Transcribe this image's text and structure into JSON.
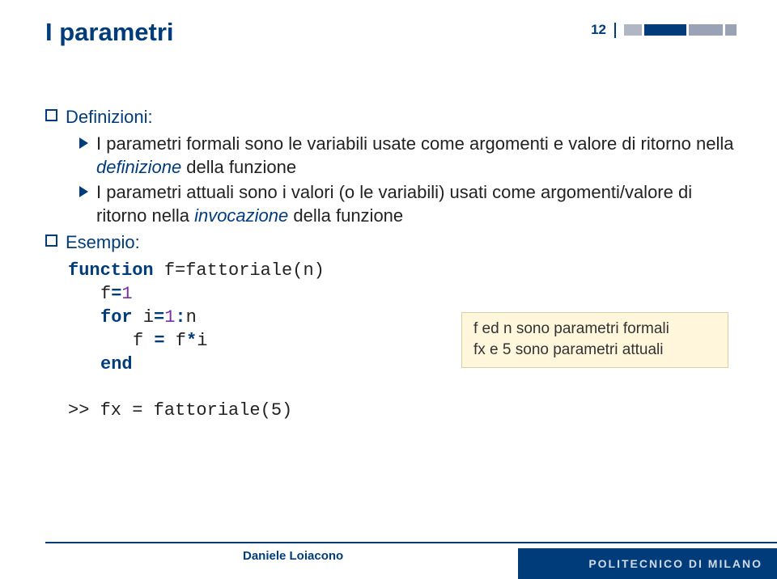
{
  "header": {
    "title": "I parametri",
    "page": "12"
  },
  "bullets": {
    "def_label": "Definizioni:",
    "sub1": "I parametri formali sono le variabili usate come argomenti e valore di ritorno nella ",
    "sub1_em": "definizione",
    "sub1_tail": " della funzione",
    "sub2": "I parametri attuali sono i valori (o le variabili) usati come argomenti/valore di ritorno nella ",
    "sub2_em": "invocazione",
    "sub2_tail": " della funzione",
    "ex_label": "Esempio:"
  },
  "code": {
    "l1_kw": "function",
    "l1_rest": " f=fattoriale(n)",
    "l2_pre": "f",
    "l2_eq": "=",
    "l2_num": "1",
    "l3_kw": "for",
    "l3_mid": " i",
    "l3_eq": "=",
    "l3_num": "1",
    "l3_colon": ":",
    "l3_tail": "n",
    "l4_pre": "f ",
    "l4_eq": "=",
    "l4_mid": " f",
    "l4_star": "*",
    "l4_tail": "i",
    "l5_kw": "end"
  },
  "note": {
    "line1": "f ed n sono parametri formali",
    "line2": "fx e 5 sono parametri attuali"
  },
  "cmd": ">> fx = fattoriale(5)",
  "footer": {
    "author": "Daniele Loiacono",
    "brand": "POLITECNICO DI MILANO"
  }
}
